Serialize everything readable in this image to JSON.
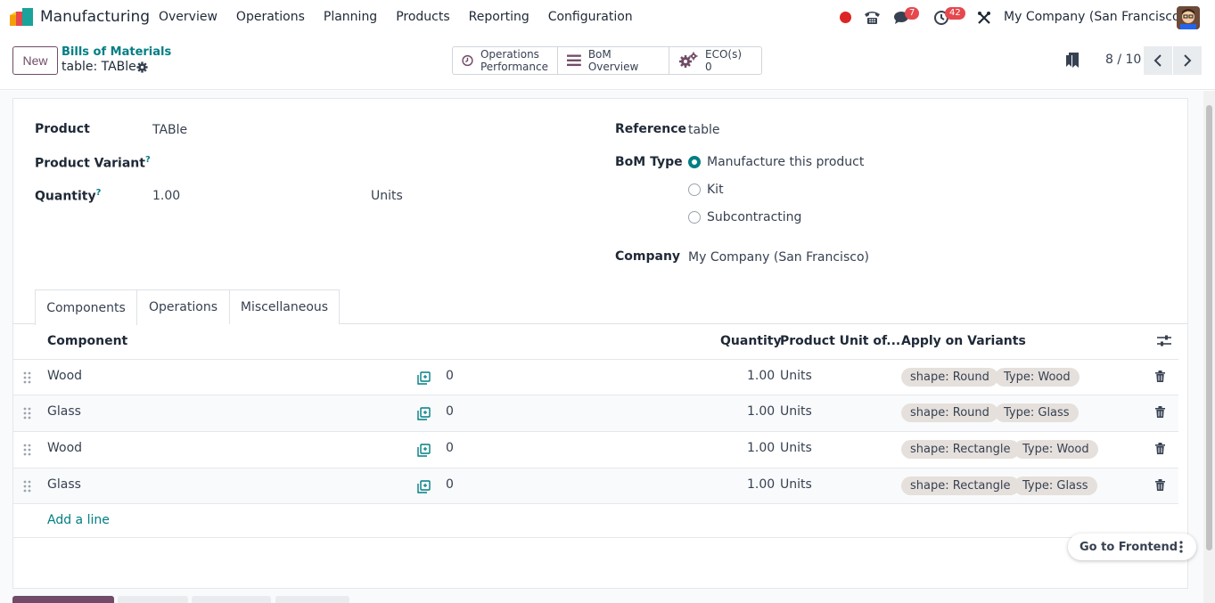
{
  "navbar": {
    "app_name": "Manufacturing",
    "menu": [
      "Overview",
      "Operations",
      "Planning",
      "Products",
      "Reporting",
      "Configuration"
    ],
    "messages_badge": "7",
    "activities_badge": "42",
    "company": "My Company (San Francisco)"
  },
  "control_panel": {
    "new_label": "New",
    "breadcrumb_parent": "Bills of Materials",
    "breadcrumb_current": "table: TABle",
    "smart_buttons": {
      "ops_perf_line1": "Operations",
      "ops_perf_line2": "Performance",
      "bom_overview": "BoM Overview",
      "eco_label": "ECO(s)",
      "eco_count": "0"
    },
    "pager": "8 / 10"
  },
  "form": {
    "product_label": "Product",
    "product_value": "TABle",
    "variant_label": "Product Variant",
    "quantity_label": "Quantity",
    "quantity_value": "1.00",
    "quantity_uom": "Units",
    "help_mark": "?",
    "reference_label": "Reference",
    "reference_value": "table",
    "bom_type_label": "BoM Type",
    "bom_types": [
      "Manufacture this product",
      "Kit",
      "Subcontracting"
    ],
    "company_label": "Company",
    "company_value": "My Company (San Francisco)"
  },
  "tabs": [
    "Components",
    "Operations",
    "Miscellaneous"
  ],
  "table": {
    "headers": {
      "component": "Component",
      "quantity": "Quantity",
      "uom": "Product Unit of...",
      "variants": "Apply on Variants"
    },
    "rows": [
      {
        "component": "Wood",
        "availability": "0",
        "quantity": "1.00",
        "uom": "Units",
        "tags": [
          "shape: Round",
          "Type: Wood"
        ]
      },
      {
        "component": "Glass",
        "availability": "0",
        "quantity": "1.00",
        "uom": "Units",
        "tags": [
          "shape: Round",
          "Type: Glass"
        ]
      },
      {
        "component": "Wood",
        "availability": "0",
        "quantity": "1.00",
        "uom": "Units",
        "tags": [
          "shape: Rectangle",
          "Type: Wood"
        ]
      },
      {
        "component": "Glass",
        "availability": "0",
        "quantity": "1.00",
        "uom": "Units",
        "tags": [
          "shape: Rectangle",
          "Type: Glass"
        ]
      }
    ],
    "add_line": "Add a line"
  },
  "go_frontend": "Go to Frontend",
  "colors": {
    "brand": "#714b67",
    "link": "#017e84",
    "badge": "#e5484d",
    "tag_bg": "#e5e0dc"
  }
}
